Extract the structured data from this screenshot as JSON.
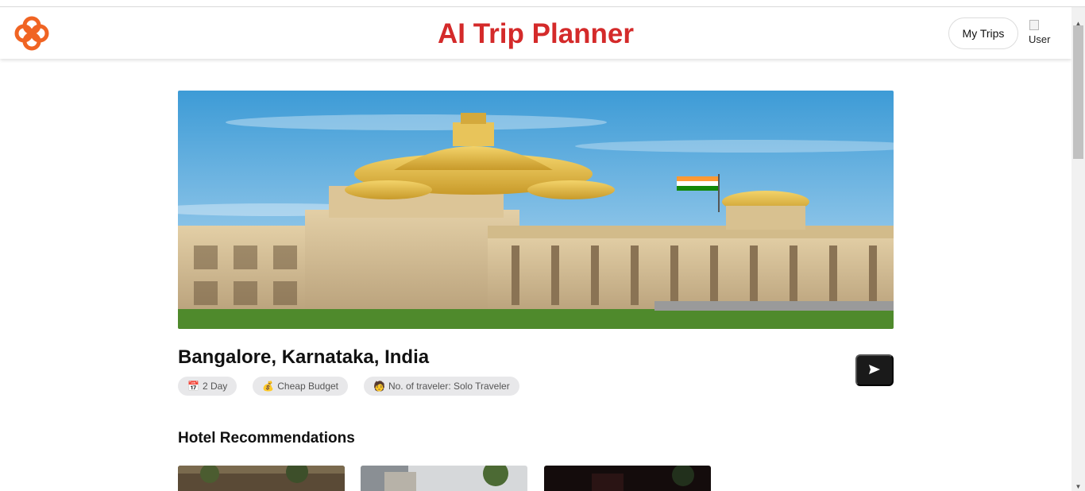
{
  "header": {
    "title": "AI Trip Planner",
    "my_trips_label": "My Trips",
    "avatar_alt": "User"
  },
  "trip": {
    "location": "Bangalore, Karnataka, India",
    "chips": [
      {
        "icon": "calendar-icon",
        "label": "2 Day"
      },
      {
        "icon": "money-bag-icon",
        "label": "Cheap Budget"
      },
      {
        "icon": "traveler-icon",
        "label": "No. of traveler: Solo Traveler"
      }
    ]
  },
  "sections": {
    "hotels_title": "Hotel Recommendations"
  },
  "colors": {
    "brand_red": "#d42a2a",
    "logo_orange": "#f06423",
    "chip_bg": "#e8e8ea",
    "button_dark": "#1a1a1a"
  }
}
